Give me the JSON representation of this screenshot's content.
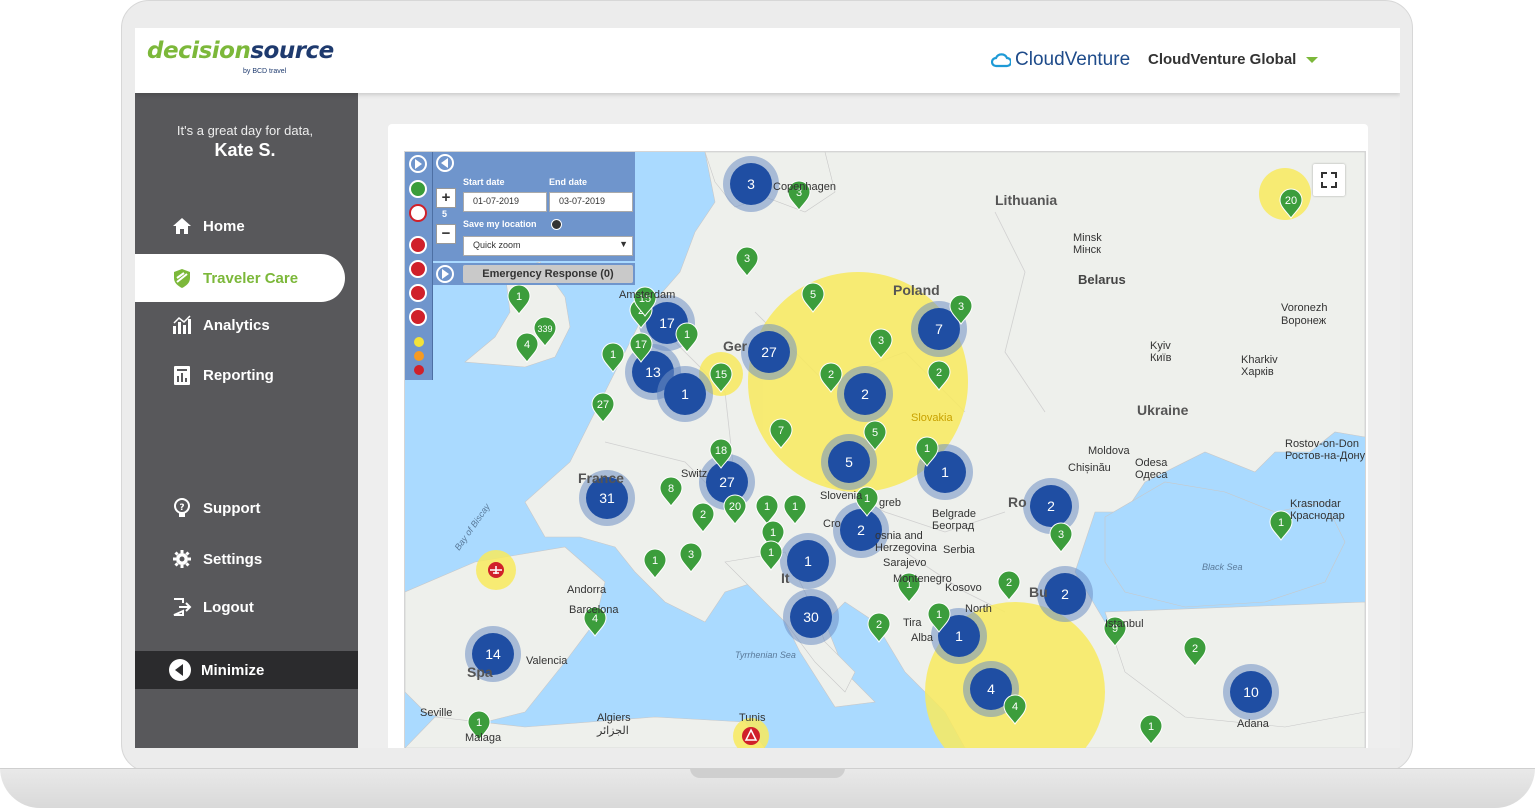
{
  "header": {
    "logo": {
      "word1": "decision",
      "word2": "source",
      "by_line": "by BCD travel"
    },
    "brand_name": "CloudVenture",
    "account_label": "CloudVenture Global"
  },
  "sidebar": {
    "greeting": "It's a great day for data,",
    "user_name": "Kate S.",
    "items": [
      {
        "label": "Home",
        "icon": "home-icon"
      },
      {
        "label": "Traveler Care",
        "icon": "shield-icon",
        "active": true
      },
      {
        "label": "Analytics",
        "icon": "analytics-icon"
      },
      {
        "label": "Reporting",
        "icon": "reporting-icon"
      }
    ],
    "bottom_items": [
      {
        "label": "Support",
        "icon": "lightbulb-icon"
      },
      {
        "label": "Settings",
        "icon": "gear-icon"
      },
      {
        "label": "Logout",
        "icon": "logout-icon"
      }
    ],
    "minimize_label": "Minimize"
  },
  "map_controls": {
    "start_date_label": "Start date",
    "end_date_label": "End date",
    "start_date": "01-07-2019",
    "end_date": "03-07-2019",
    "save_location_label": "Save my location",
    "quick_zoom": "Quick zoom",
    "zoom_level": "5",
    "emergency_response": "Emergency Response (0)",
    "legend_colors": [
      "#f2e23a",
      "#f59a23",
      "#d0202a"
    ]
  },
  "map_labels": {
    "lithuania": "Lithuania",
    "minsk": "Minsk",
    "minsk_local": "Мінск",
    "belarus": "Belarus",
    "poland": "Poland",
    "ukraine": "Ukraine",
    "kyiv": "Kyiv",
    "kyiv_local": "Київ",
    "voronezh": "Voronezh",
    "voronezh_local": "Воронеж",
    "kharkiv": "Kharkiv",
    "kharkiv_local": "Харків",
    "moldova": "Moldova",
    "chisinau": "Chișinău",
    "odesa": "Odesa",
    "odesa_local": "Одеса",
    "rostov": "Rostov-on-Don",
    "rostov_local": "Ростов-на-Дону",
    "krasnodar": "Krasnodar",
    "krasnodar_local": "Краснодар",
    "black_sea": "Black Sea",
    "france": "France",
    "bay_of_biscay": "Bay of Biscay",
    "andorra": "Andorra",
    "valencia": "Valencia",
    "seville": "Seville",
    "malaga": "Malaga",
    "algiers": "Algiers",
    "algiers_local": "الجزائر",
    "tunis": "Tunis",
    "tyrrhenian": "Tyrrhenian Sea",
    "slovenia": "Slovenia",
    "zagreb": "greb",
    "bosnia": "osnia and",
    "herzegovina": "Herzegovina",
    "serbia": "Serbia",
    "belgrade": "Belgrade",
    "belgrade_local": "Београд",
    "sarajevo": "Sarajevo",
    "montenegro": "Montenegro",
    "kosovo": "Kosovo",
    "north": "North",
    "slovakia": "Slovakia",
    "amsterdam": "Amsterdam",
    "copenhagen": "Copenhagen",
    "ger": "Ger",
    "ro": "Ro",
    "bu": "Bu",
    "alba": "Alba",
    "tira": "Tira",
    "switz": "Switz",
    "cro": "Cro",
    "it": "It",
    "sp": "Spa",
    "barcelona": "Barcelona",
    "istanbul": "Istanbul",
    "adana": "Adana"
  },
  "clusters": [
    {
      "count": "3"
    },
    {
      "count": "17"
    },
    {
      "count": "27"
    },
    {
      "count": "7"
    },
    {
      "count": "13"
    },
    {
      "count": "1"
    },
    {
      "count": "2"
    },
    {
      "count": "5"
    },
    {
      "count": "1"
    },
    {
      "count": "31"
    },
    {
      "count": "27"
    },
    {
      "count": "2"
    },
    {
      "count": "2"
    },
    {
      "count": "1"
    },
    {
      "count": "30"
    },
    {
      "count": "1"
    },
    {
      "count": "2"
    },
    {
      "count": "14"
    },
    {
      "count": "4"
    },
    {
      "count": "10"
    }
  ],
  "pins": [
    {
      "count": "3"
    },
    {
      "count": "3"
    },
    {
      "count": "1"
    },
    {
      "count": "339"
    },
    {
      "count": "4"
    },
    {
      "count": "2"
    },
    {
      "count": "15"
    },
    {
      "count": "17"
    },
    {
      "count": "1"
    },
    {
      "count": "1"
    },
    {
      "count": "5"
    },
    {
      "count": "3"
    },
    {
      "count": "3"
    },
    {
      "count": "2"
    },
    {
      "count": "2"
    },
    {
      "count": "15"
    },
    {
      "count": "27"
    },
    {
      "count": "7"
    },
    {
      "count": "5"
    },
    {
      "count": "18"
    },
    {
      "count": "8"
    },
    {
      "count": "2"
    },
    {
      "count": "20"
    },
    {
      "count": "1"
    },
    {
      "count": "1"
    },
    {
      "count": "1"
    },
    {
      "count": "1"
    },
    {
      "count": "3"
    },
    {
      "count": "1"
    },
    {
      "count": "1"
    },
    {
      "count": "3"
    },
    {
      "count": "4"
    },
    {
      "count": "1"
    },
    {
      "count": "2"
    },
    {
      "count": "1"
    },
    {
      "count": "2"
    },
    {
      "count": "9"
    },
    {
      "count": "2"
    },
    {
      "count": "4"
    },
    {
      "count": "1"
    },
    {
      "count": "1"
    },
    {
      "count": "1"
    },
    {
      "count": "20"
    },
    {
      "count": "1"
    }
  ]
}
